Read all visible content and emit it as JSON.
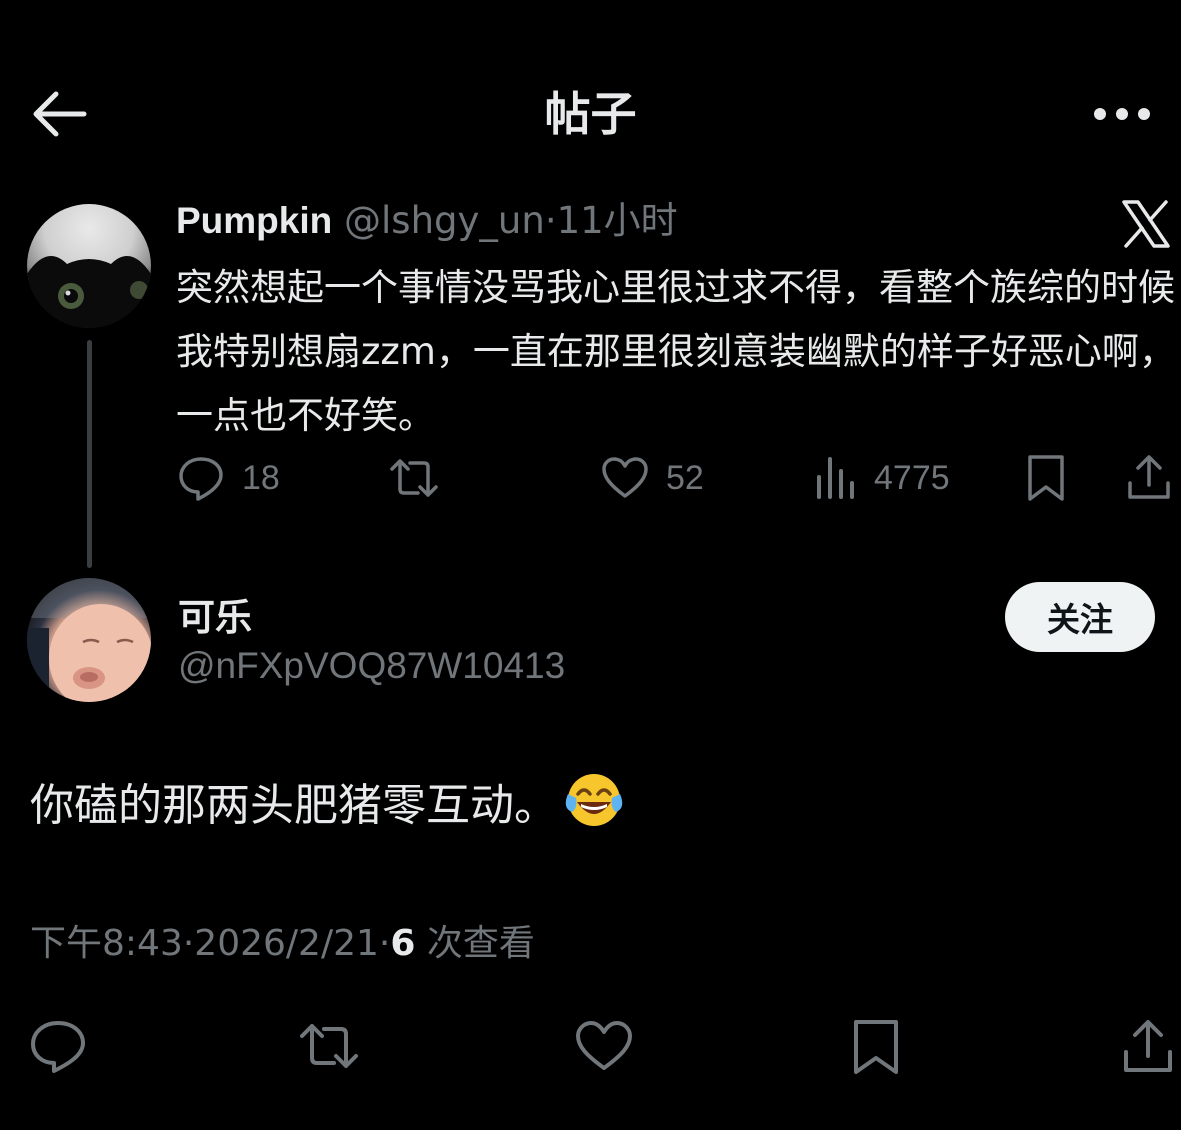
{
  "header": {
    "title": "帖子"
  },
  "parent_tweet": {
    "author_name": "Pumpkin",
    "handle": "@lshgy_un",
    "separator": "·",
    "time_ago": "11小时",
    "text": "突然想起一个事情没骂我心里很过求不得，看整个族综的时候我特别想扇zzm，一直在那里很刻意装幽默的样子好恶心啊，一点也不好笑。",
    "replies": "18",
    "likes": "52",
    "views": "4775"
  },
  "reply": {
    "author_name": "可乐",
    "handle": "@nFXpVOQ87W10413",
    "follow_label": "关注",
    "text": "你磕的那两头肥猪零互动。",
    "emoji": "face-with-tears-of-joy",
    "time": "下午8:43",
    "sep1": "·",
    "date": "2026/2/21",
    "sep2": "·",
    "view_count": "6",
    "view_label": "次查看"
  },
  "colors": {
    "background": "#000000",
    "text_primary": "#e7e9ea",
    "text_muted": "#71767b",
    "thread_line": "#3a3d41",
    "follow_bg": "#eff3f4"
  },
  "icons": [
    "back-arrow-icon",
    "more-icon",
    "x-logo-icon",
    "reply-icon",
    "repost-icon",
    "like-icon",
    "views-icon",
    "bookmark-icon",
    "share-icon"
  ]
}
